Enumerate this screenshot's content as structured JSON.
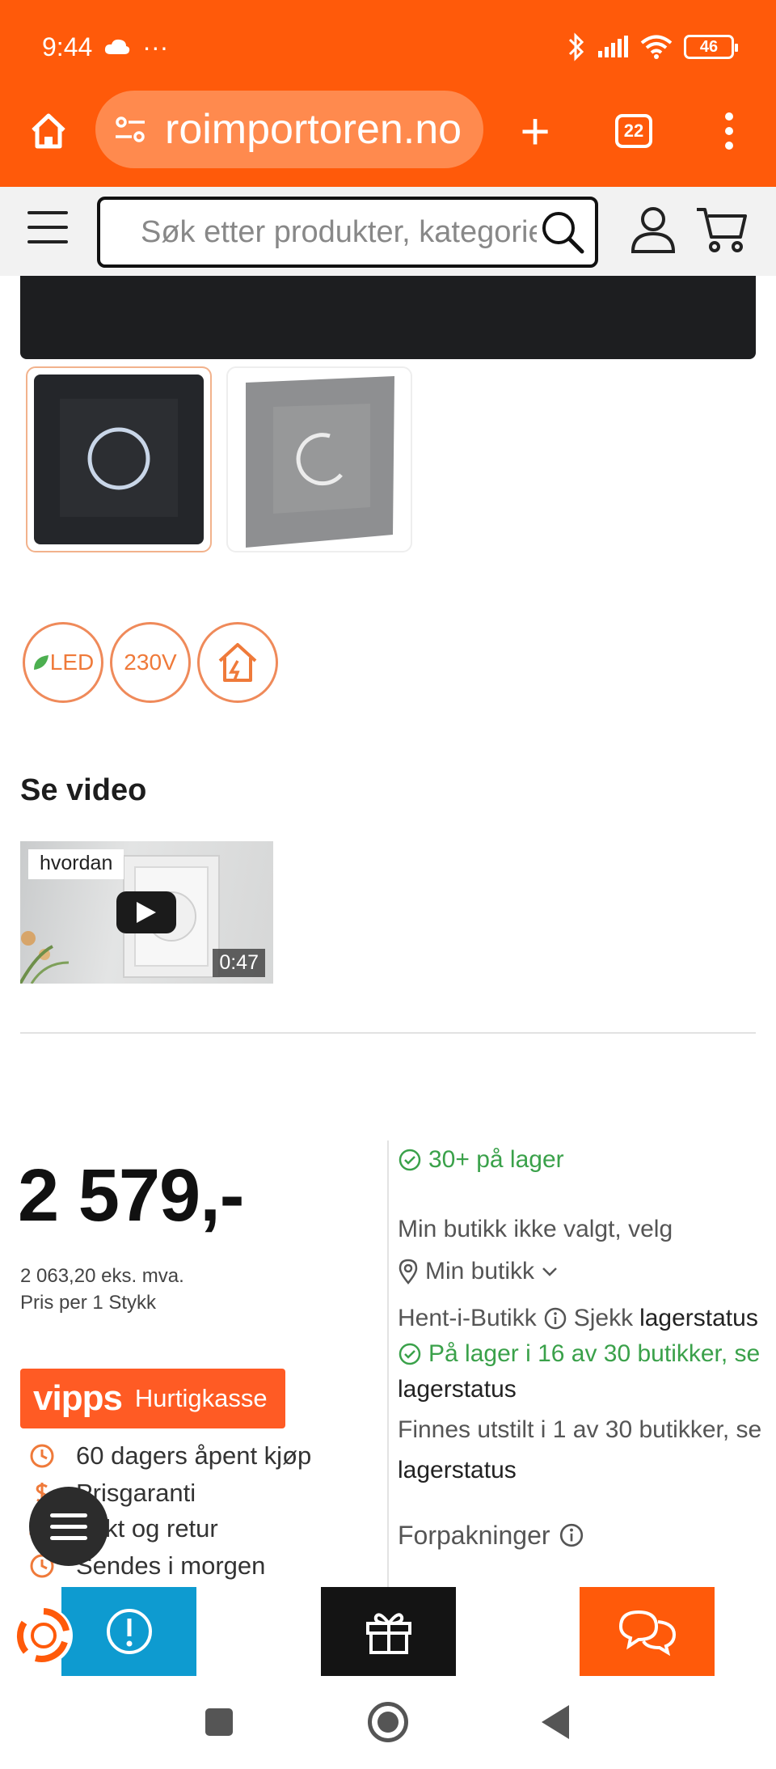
{
  "status_bar": {
    "time": "9:44",
    "dots": "···",
    "battery": "46"
  },
  "browser": {
    "url": "roimportoren.no",
    "tab_count": "22",
    "new_tab": "+"
  },
  "site_header": {
    "search_placeholder": "Søk etter produkter, kategorier"
  },
  "product": {
    "features": {
      "led": "LED",
      "voltage": "230V"
    },
    "video": {
      "heading": "Se video",
      "tag": "hvordan",
      "duration": "0:47"
    },
    "price": {
      "main": "2 579,-",
      "ex_vat": "2 063,20 eks. mva.",
      "per_unit": "Pris per 1 Stykk"
    },
    "vipps": {
      "logo": "vipps",
      "label": "Hurtigkasse"
    },
    "usps": [
      "60 dagers åpent kjøp",
      "Prisgaranti",
      "frakt og retur",
      "Sendes i morgen"
    ],
    "stock": {
      "in_stock": "30+ på lager",
      "store_line": "Min butikk ikke valgt, velg",
      "my_store": "Min butikk",
      "pickup": "Hent-i-Butikk",
      "check": "Sjekk",
      "check_link": "lagerstatus",
      "shops": "På lager i 16 av 30 butikker, se",
      "shops_link": "lagerstatus",
      "display": "Finnes utstilt i 1 av 30 butikker, se",
      "display_link": "lagerstatus",
      "packaging": "Forpakninger"
    }
  },
  "colors": {
    "brand_orange": "#ff5a0a",
    "vipps_orange": "#ff5b24",
    "stock_green": "#3aa14a",
    "info_blue": "#0e9bd0"
  }
}
